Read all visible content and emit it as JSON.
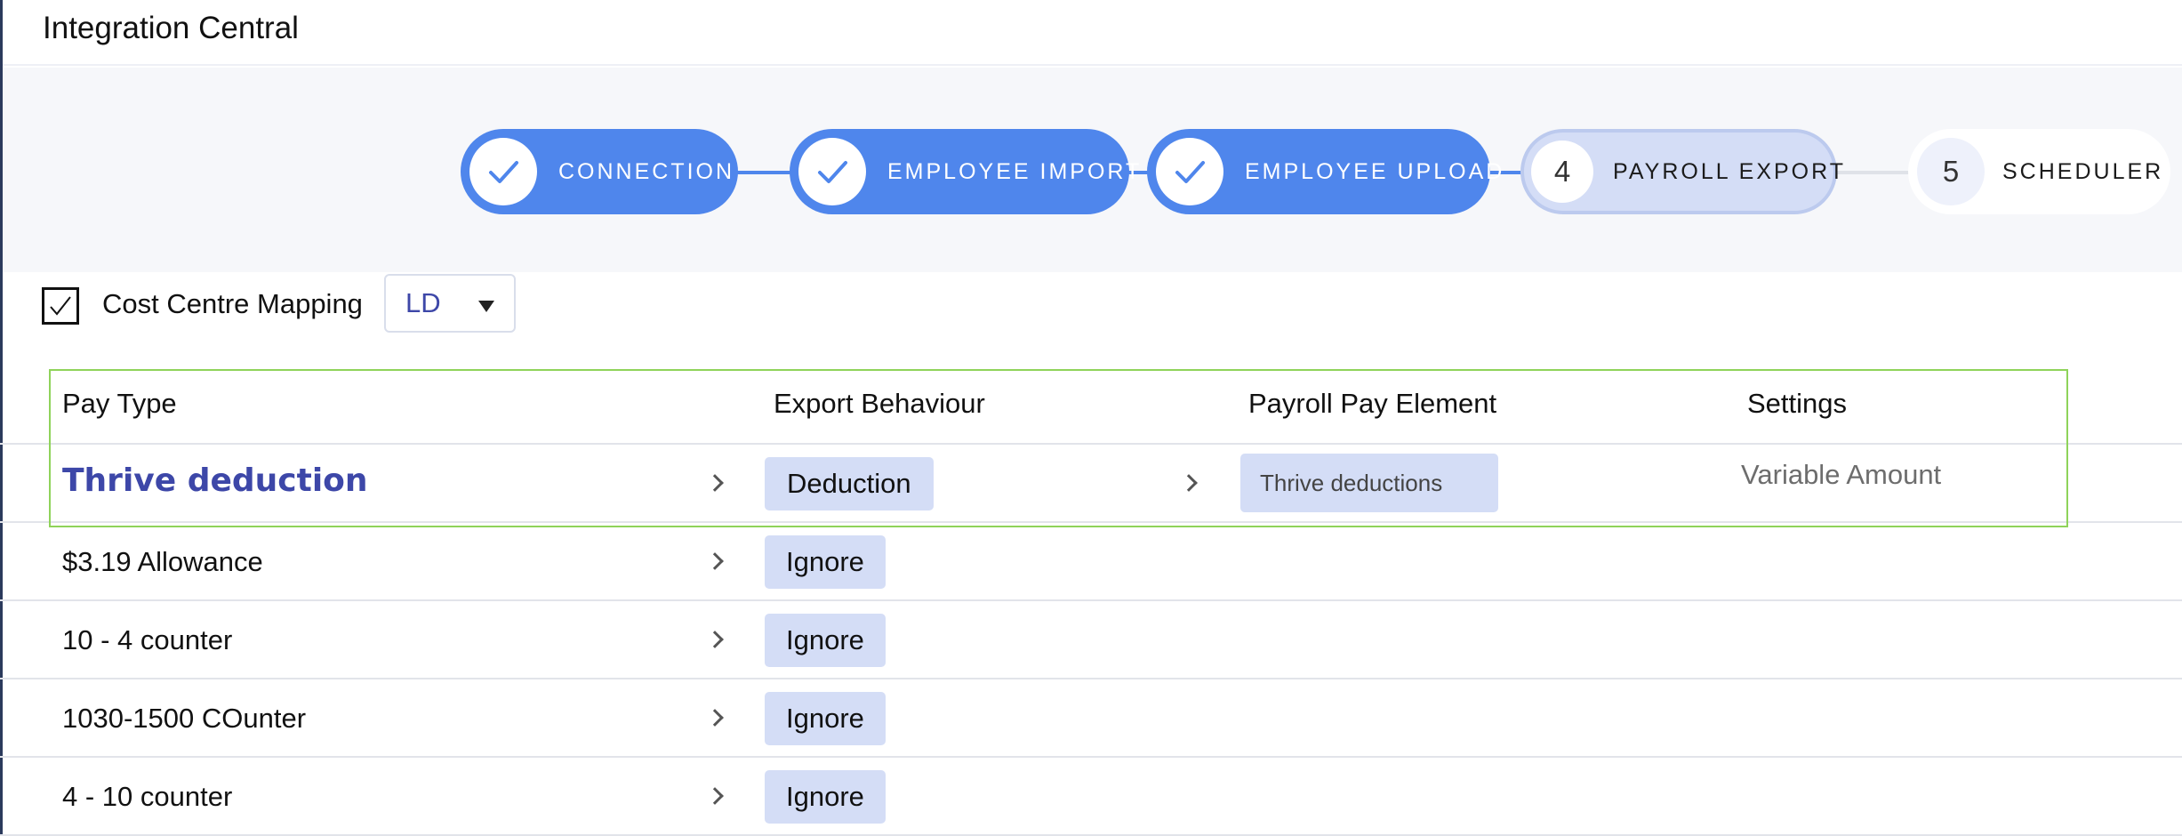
{
  "header": {
    "title": "Integration Central"
  },
  "stepper": {
    "steps": [
      {
        "label": "CONNECTION",
        "state": "done",
        "icon": "check-icon"
      },
      {
        "label": "EMPLOYEE IMPORT",
        "state": "done",
        "icon": "check-icon"
      },
      {
        "label": "EMPLOYEE UPLOAD",
        "state": "done",
        "icon": "check-icon"
      },
      {
        "label": "PAYROLL EXPORT",
        "state": "current",
        "number": "4"
      },
      {
        "label": "SCHEDULER",
        "state": "todo",
        "number": "5"
      }
    ]
  },
  "cost_centre": {
    "label": "Cost Centre Mapping",
    "checked": true,
    "select_value": "LD"
  },
  "table": {
    "headers": [
      "Pay Type",
      "Export Behaviour",
      "Payroll Pay Element",
      "Settings"
    ],
    "rows": [
      {
        "pay_type": "Thrive deduction",
        "behaviour": "Deduction",
        "pay_element": "Thrive deductions",
        "settings": "Variable Amount"
      },
      {
        "pay_type": "$3.19 Allowance",
        "behaviour": "Ignore"
      },
      {
        "pay_type": "10 - 4 counter",
        "behaviour": "Ignore"
      },
      {
        "pay_type": "1030-1500 COunter",
        "behaviour": "Ignore"
      },
      {
        "pay_type": "4 - 10 counter",
        "behaviour": "Ignore"
      }
    ]
  },
  "colors": {
    "accent": "#4f86ec",
    "current_step": "#d4ddf6",
    "highlight_text": "#3d47a8",
    "selection_border": "#8fd35a"
  }
}
